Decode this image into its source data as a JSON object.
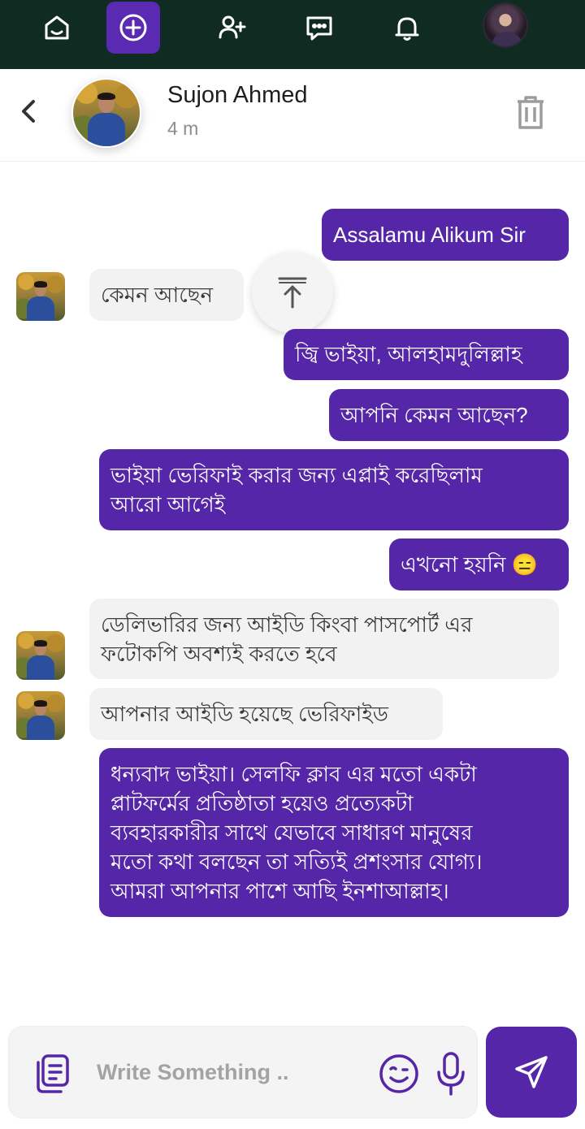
{
  "nav": {
    "items": [
      "home-icon",
      "add-circle-icon",
      "add-user-icon",
      "messages-icon",
      "bell-icon",
      "profile-avatar"
    ],
    "active": "add-circle-icon",
    "background": "#0f2b22",
    "accent": "#5b2ab3"
  },
  "chat": {
    "contact_name": "Sujon Ahmed",
    "status": "4 m"
  },
  "messages": [
    {
      "side": "out",
      "text": "Assalamu Alikum Sir"
    },
    {
      "side": "in",
      "text": "কেমন আছেন"
    },
    {
      "side": "out",
      "text": "জ্বি ভাইয়া, আলহামদুলিল্লাহ"
    },
    {
      "side": "out",
      "text": "আপনি কেমন আছেন?"
    },
    {
      "side": "out",
      "text": "ভাইয়া ভেরিফাই করার জন্য এপ্লাই করেছিলাম\nআরো আগেই"
    },
    {
      "side": "out",
      "text": "এখনো হয়নি 😑"
    },
    {
      "side": "in",
      "text": "ডেলিভারির জন্য আইডি কিংবা পাসপোর্ট এর\nফটোকপি অবশ্যই করতে হবে"
    },
    {
      "side": "in",
      "text": "আপনার আইডি হয়েছে ভেরিফাইড"
    },
    {
      "side": "out",
      "text": "ধন্যবাদ ভাইয়া। সেলফি ক্লাব এর মতো একটা\nপ্লাটফর্মের প্রতিষ্ঠাতা হয়েও প্রত্যেকটা\nব্যবহারকারীর সাথে যেভাবে সাধারণ মানুষের\nমতো কথা বলছেন তা সত্যিই প্রশংসার যোগ্য।\nআমরা আপনার পাশে আছি ইনশাআল্লাহ।"
    }
  ],
  "composer": {
    "placeholder": "Write Something .."
  },
  "colors": {
    "outgoing_bubble": "#5626a8",
    "incoming_bubble": "#f2f2f2"
  }
}
